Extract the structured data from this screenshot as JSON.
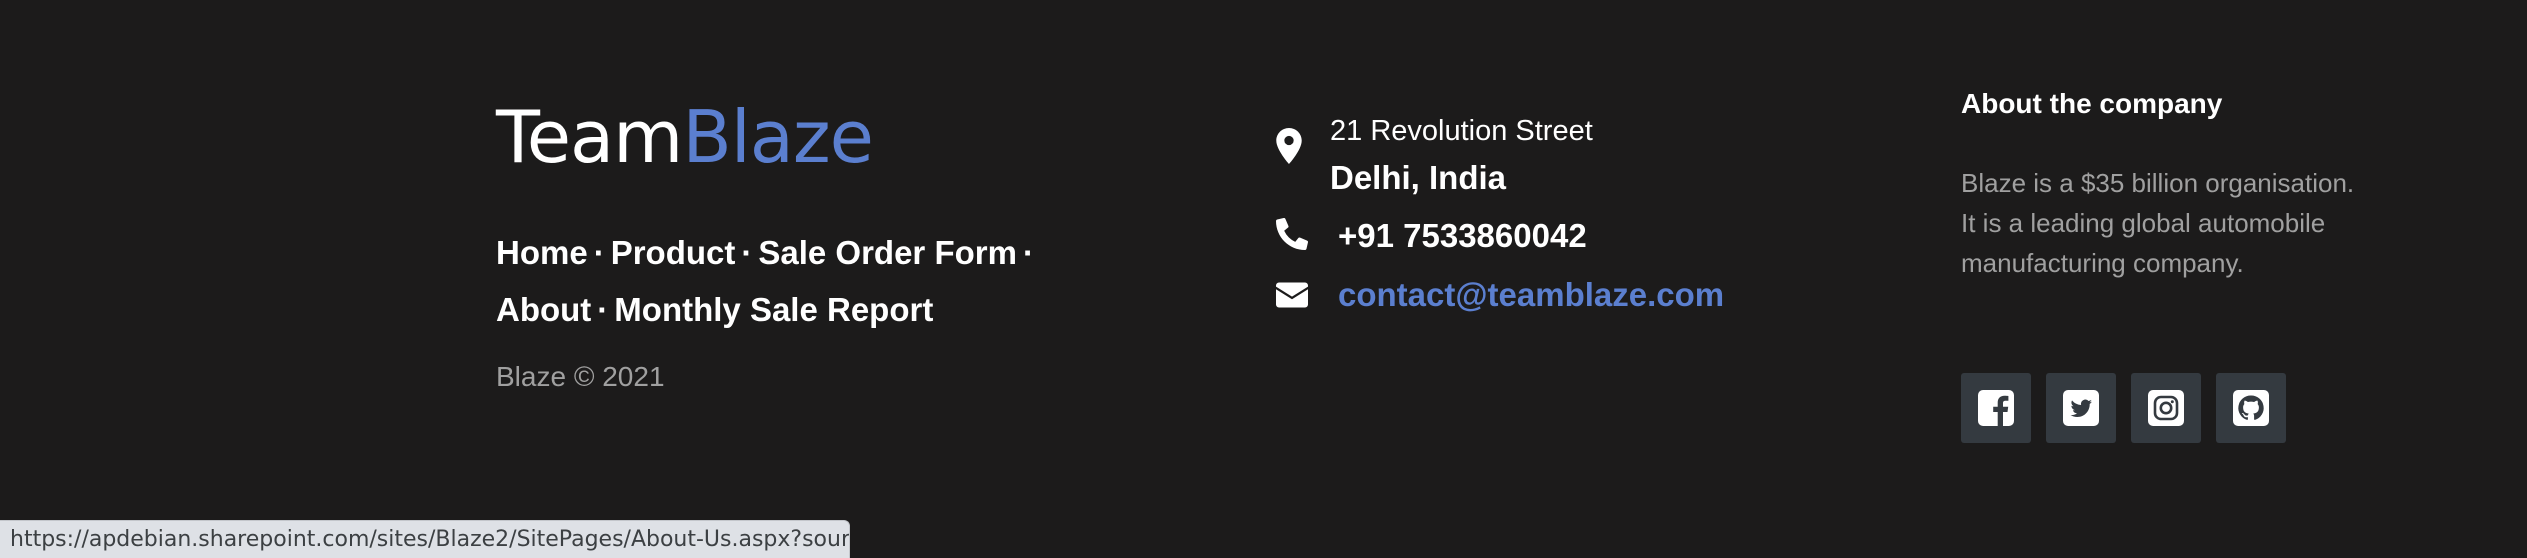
{
  "brand": {
    "part1": "Team",
    "part2": "Blaze"
  },
  "nav": {
    "items": [
      "Home",
      "Product",
      "Sale Order Form",
      "About",
      "Monthly Sale Report"
    ],
    "separator": "·"
  },
  "copyright": "Blaze © 2021",
  "contact": {
    "address_line1": "21 Revolution Street",
    "address_line2": "Delhi, India",
    "phone": "+91 7533860042",
    "email": "contact@teamblaze.com"
  },
  "about": {
    "title": "About the company",
    "text": "Blaze is a $35 billion organisation. It is a leading global automobile manufacturing company."
  },
  "social": [
    "facebook-icon",
    "twitter-icon",
    "instagram-icon",
    "github-icon"
  ],
  "status_bar": {
    "url": "https://apdebian.sharepoint.com/sites/Blaze2/SitePages/About-Us.aspx?sour..."
  },
  "colors": {
    "background": "#1c1b1b",
    "accent": "#5b7fcf",
    "muted_text": "#a0a0a0",
    "social_button_bg": "#343a40"
  }
}
